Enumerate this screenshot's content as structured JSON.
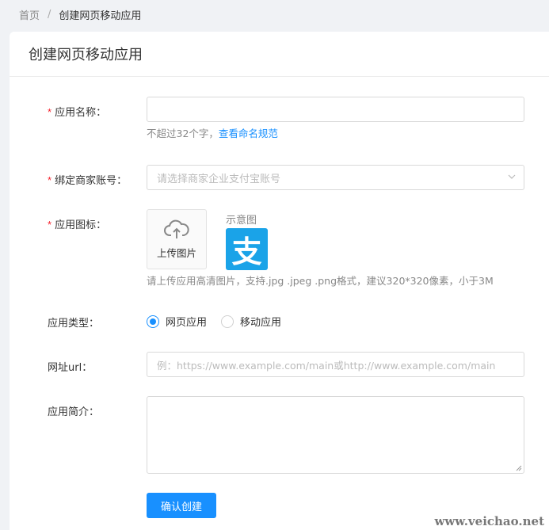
{
  "breadcrumb": {
    "home": "首页",
    "separator": "/",
    "current": "创建网页移动应用"
  },
  "card": {
    "title": "创建网页移动应用"
  },
  "form": {
    "required_mark": "*",
    "app_name": {
      "label": "应用名称：",
      "value": "",
      "help_text": "不超过32个字，",
      "help_link": "查看命名规范"
    },
    "merchant_account": {
      "label": "绑定商家账号：",
      "placeholder": "请选择商家企业支付宝账号"
    },
    "app_icon": {
      "label": "应用图标：",
      "upload_label": "上传图片",
      "sample_label": "示意图",
      "sample_glyph": "支",
      "help_text": "请上传应用高清图片，支持.jpg .jpeg .png格式，建议320*320像素，小于3M"
    },
    "app_type": {
      "label": "应用类型：",
      "options": [
        "网页应用",
        "移动应用"
      ],
      "selected": "网页应用"
    },
    "url": {
      "label": "网址url：",
      "placeholder": "例：https://www.example.com/main或http://www.example.com/main"
    },
    "intro": {
      "label": "应用简介：",
      "value": ""
    },
    "submit_label": "确认创建"
  },
  "watermark": "www.veichao.net",
  "colors": {
    "primary": "#1890ff",
    "required": "#f5222d",
    "alipay": "#1aa3e8"
  }
}
